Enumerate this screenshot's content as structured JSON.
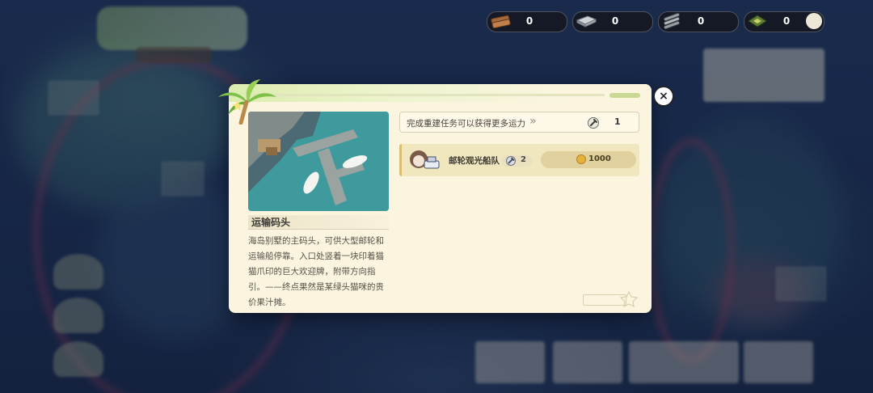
{
  "resources": [
    {
      "icon": "wood-plank-icon",
      "value": "0"
    },
    {
      "icon": "steel-plate-icon",
      "value": "0"
    },
    {
      "icon": "pipe-bundle-icon",
      "value": "0"
    },
    {
      "icon": "circuit-chip-icon",
      "value": "0"
    }
  ],
  "dialog": {
    "place_name": "运输码头",
    "description": "海岛别墅的主码头，可供大型邮轮和运输船停靠。入口处竖着一块印着猫猫爪印的巨大欢迎牌，附带方向指引。——终点果然是某绿头猫咪的贵价果汁摊。",
    "task": {
      "text": "完成重建任务可以获得更多运力",
      "arrows": "»",
      "reward_icon": "wrench-icon",
      "reward_value": "1"
    },
    "unit": {
      "name": "邮轮观光船队",
      "level_icon": "wrench-icon",
      "level": "2",
      "cost_icon": "coin-icon",
      "cost": "1000"
    },
    "close_icon": "close-icon",
    "close_label": "×"
  },
  "colors": {
    "panel": "#fbf5e0",
    "header_green": "#dcecae",
    "unit_bg": "#f1e7be",
    "cost_bg": "#e0d19e"
  }
}
